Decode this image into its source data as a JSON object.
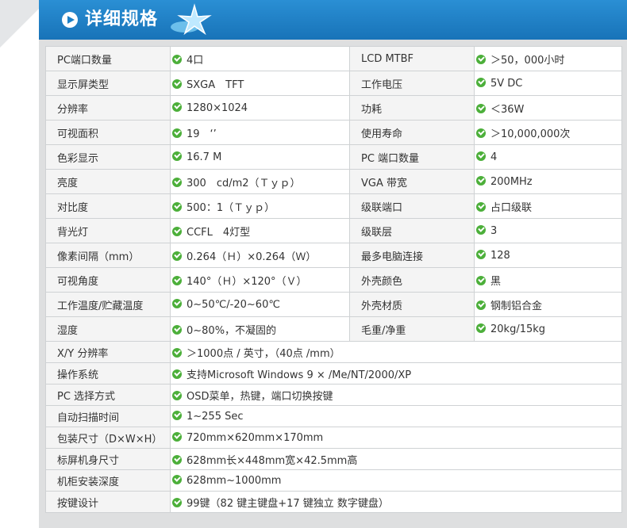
{
  "header": {
    "title": "详细规格",
    "icon": "play-icon",
    "decoration": "starfish-icon"
  },
  "colors": {
    "header_blue": "#1d80c6",
    "check_green": "#4caf3a"
  },
  "spec_rows": [
    {
      "l1": "PC端口数量",
      "v1": "4口",
      "l2": "LCD MTBF",
      "v2": "＞50，000小时"
    },
    {
      "l1": "显示屏类型",
      "v1": "SXGA　TFT",
      "l2": "工作电压",
      "v2": "5V DC"
    },
    {
      "l1": "分辨率",
      "v1": "1280×1024",
      "l2": "功耗",
      "v2": "＜36W"
    },
    {
      "l1": "可视面积",
      "v1": "19　‘’",
      "l2": "使用寿命",
      "v2": "＞10,000,000次"
    },
    {
      "l1": "色彩显示",
      "v1": "16.7 M",
      "l2": "PC 端口数量",
      "v2": "4"
    },
    {
      "l1": "亮度",
      "v1": "300　cd/m2（Ｔｙｐ）",
      "l2": "VGA 带宽",
      "v2": "200MHz"
    },
    {
      "l1": "对比度",
      "v1": "500：1（Ｔｙｐ）",
      "l2": "级联端口",
      "v2": "占口级联"
    },
    {
      "l1": "背光灯",
      "v1": "CCFL　4灯型",
      "l2": "级联层",
      "v2": "3"
    },
    {
      "l1": "像素间隔（mm）",
      "v1": "0.264（Ｈ）×0.264（Ｗ）",
      "l2": "最多电脑连接",
      "v2": "128"
    },
    {
      "l1": "可视角度",
      "v1": "140°（Ｈ）×120°（Ｖ）",
      "l2": "外壳颜色",
      "v2": "黑"
    },
    {
      "l1": "工作温度/贮藏温度",
      "v1": "0~50℃/-20~60℃",
      "l2": "外壳材质",
      "v2": "钢制铝合金"
    },
    {
      "l1": "湿度",
      "v1": "0~80%，不凝固的",
      "l2": "毛重/净重",
      "v2": "20kg/15kg"
    }
  ],
  "wide_rows": [
    {
      "l": "X/Y 分辨率",
      "v": "＞1000点 / 英寸，（40点 /mm）"
    },
    {
      "l": "操作系统",
      "v": "支持Microsoft Windows 9 × /Me/NT/2000/XP"
    },
    {
      "l": "PC 选择方式",
      "v": "OSD菜单，热键，端口切换按键"
    },
    {
      "l": "自动扫描时间",
      "v": "1~255 Sec"
    },
    {
      "l": "包装尺寸（D×W×H）",
      "v": "720mm×620mm×170mm"
    },
    {
      "l": "标屏机身尺寸",
      "v": "628mm长×448mm宽×42.5mm高"
    },
    {
      "l": "机柜安装深度",
      "v": "628mm~1000mm"
    },
    {
      "l": "按键设计",
      "v": "99键（82 键主键盘+17 键独立 数字键盘）"
    }
  ]
}
